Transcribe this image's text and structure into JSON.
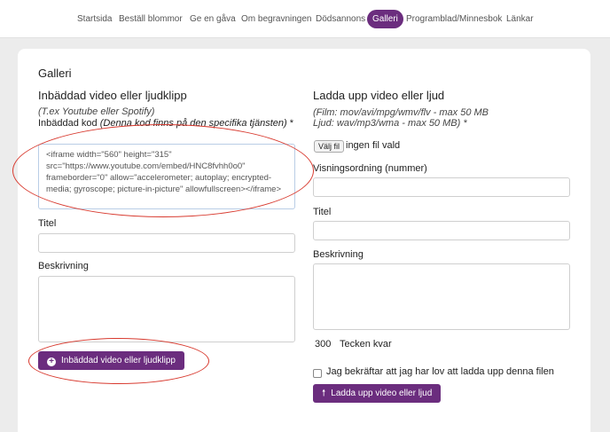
{
  "nav": {
    "items": [
      {
        "label": "Startsida"
      },
      {
        "label": "Beställ blommor"
      },
      {
        "label": "Ge en gåva"
      },
      {
        "label": "Om begravningen"
      },
      {
        "label": "Dödsannons"
      },
      {
        "label": "Galleri",
        "active": true
      },
      {
        "label": "Programblad/Minnesbok"
      },
      {
        "label": "Länkar"
      }
    ]
  },
  "page": {
    "title": "Galleri"
  },
  "embed_section": {
    "heading": "Inbäddad video eller ljudklipp",
    "hint": "(T.ex Youtube eller Spotify)",
    "code_label": "Inbäddad kod",
    "code_hint": "(Denna kod finns på den specifika tjänsten)",
    "code_required": "*",
    "code_value": "<iframe width=\"560\" height=\"315\"\nsrc=\"https://www.youtube.com/embed/HNC8fvhh0o0\"\nframeborder=\"0\" allow=\"accelerometer; autoplay; encrypted-\nmedia; gyroscope; picture-in-picture\" allowfullscreen></iframe>",
    "title_label": "Titel",
    "title_value": "",
    "desc_label": "Beskrivning",
    "desc_value": "",
    "submit_label": "Inbäddad video eller ljudklipp",
    "submit_icon": "plus-circle-icon"
  },
  "upload_section": {
    "heading": "Ladda upp video eller ljud",
    "hint_line1": "(Film: mov/avi/mpg/wmv/flv - max 50 MB",
    "hint_line2": "Ljud: wav/mp3/wma - max 50 MB)",
    "hint_required": "*",
    "choose_file_label": "Välj fil",
    "no_file_text": "ingen fil vald",
    "order_label": "Visningsordning (nummer)",
    "order_value": "",
    "title_label": "Titel",
    "title_value": "",
    "desc_label": "Beskrivning",
    "desc_value": "",
    "char_count": "300",
    "char_count_suffix": "Tecken kvar",
    "consent_label": "Jag bekräftar att jag har lov att ladda upp denna filen",
    "consent_checked": false,
    "submit_label": "Ladda upp video eller ljud",
    "submit_icon": "arrow-up-icon"
  },
  "colors": {
    "accent": "#6b2d7e",
    "annotation": "#d83a2f",
    "background": "#ececec"
  }
}
